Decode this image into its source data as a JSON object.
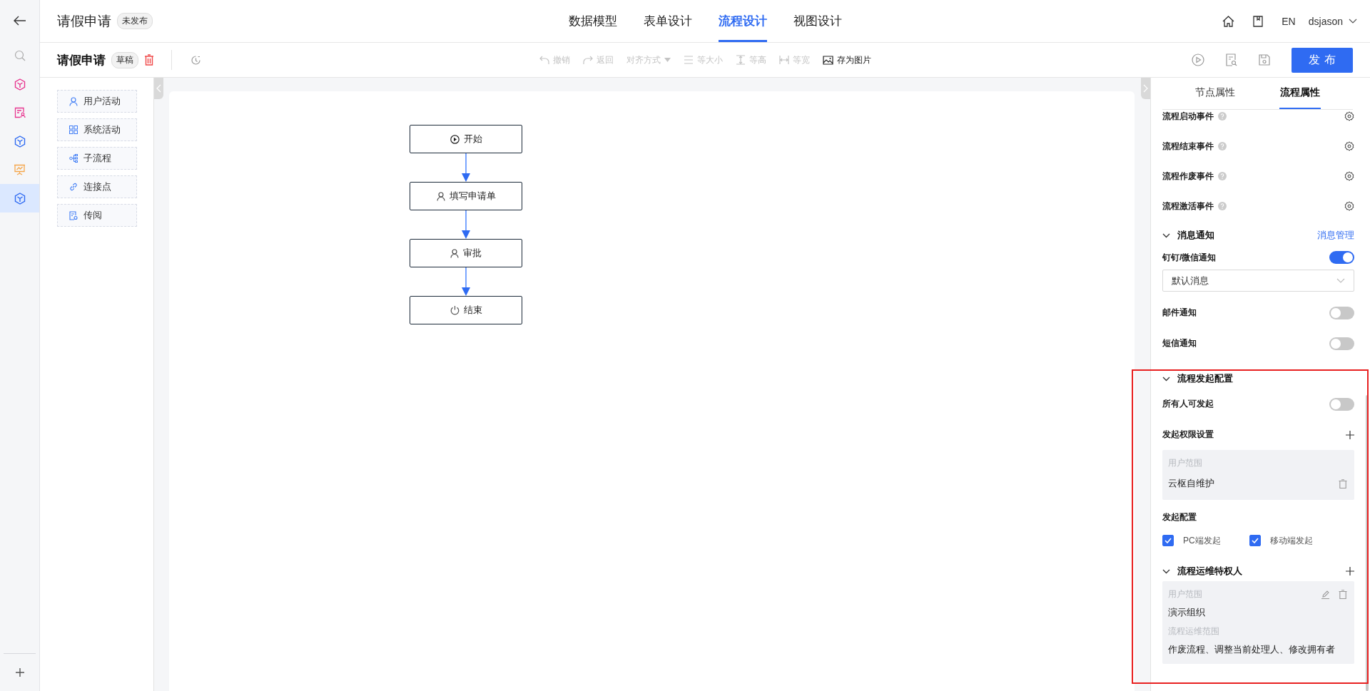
{
  "rail": {
    "items": [
      {
        "kind": "search",
        "selected": false
      },
      {
        "kind": "cube",
        "color": "#e8368f",
        "selected": false
      },
      {
        "kind": "form",
        "color": "#e8368f",
        "selected": false
      },
      {
        "kind": "cube",
        "color": "#2f6bf2",
        "selected": false
      },
      {
        "kind": "board",
        "color": "#f5a74c",
        "selected": false
      },
      {
        "kind": "cube",
        "color": "#2f6bf2",
        "selected": true
      }
    ]
  },
  "header": {
    "title": "请假申请",
    "status": "未发布",
    "tabs": [
      {
        "label": "数据模型",
        "selected": false
      },
      {
        "label": "表单设计",
        "selected": false
      },
      {
        "label": "流程设计",
        "selected": true
      },
      {
        "label": "视图设计",
        "selected": false
      }
    ],
    "language": "EN",
    "user": "dsjason"
  },
  "toolbar": {
    "title": "请假申请",
    "status": "草稿",
    "actions": [
      {
        "kind": "undo",
        "label": "撤销",
        "disabled": true
      },
      {
        "kind": "redo",
        "label": "返回",
        "disabled": true
      },
      {
        "kind": "align",
        "label": "对齐方式",
        "disabled": true
      },
      {
        "kind": "same-size",
        "label": "等大小",
        "disabled": true
      },
      {
        "kind": "same-height",
        "label": "等高",
        "disabled": true
      },
      {
        "kind": "same-width",
        "label": "等宽",
        "disabled": true
      },
      {
        "kind": "image",
        "label": "存为图片",
        "disabled": false
      }
    ],
    "publish": "发布"
  },
  "palette": [
    {
      "kind": "user",
      "label": "用户活动"
    },
    {
      "kind": "grid",
      "label": "系统活动"
    },
    {
      "kind": "subflow",
      "label": "子流程"
    },
    {
      "kind": "link",
      "label": "连接点"
    },
    {
      "kind": "doc",
      "label": "传阅"
    }
  ],
  "flow": {
    "nodes": [
      {
        "kind": "start",
        "label": "开始"
      },
      {
        "kind": "user",
        "label": "填写申请单"
      },
      {
        "kind": "user",
        "label": "审批"
      },
      {
        "kind": "end",
        "label": "结束"
      }
    ]
  },
  "panel": {
    "tabs": [
      {
        "label": "节点属性",
        "selected": false
      },
      {
        "label": "流程属性",
        "selected": true
      }
    ],
    "events": [
      "流程启动事件",
      "流程结束事件",
      "流程作废事件",
      "流程激活事件"
    ],
    "notify": {
      "title": "消息通知",
      "expanded": true,
      "link": "消息管理",
      "channels": [
        {
          "label": "钉钉/微信通知",
          "on": true,
          "template": "默认消息"
        },
        {
          "label": "邮件通知",
          "on": false
        },
        {
          "label": "短信通知",
          "on": false
        }
      ]
    },
    "launch": {
      "title": "流程发起配置",
      "expanded": true,
      "everyone": {
        "label": "所有人可发起",
        "on": false
      },
      "permission_title": "发起权限设置",
      "scope_label": "用户范围",
      "scope": "云枢自维护",
      "config_title": "发起配置",
      "options": [
        {
          "label": "PC端发起",
          "checked": true
        },
        {
          "label": "移动端发起",
          "checked": true
        }
      ]
    },
    "admins": {
      "title": "流程运维特权人",
      "expanded": true,
      "scope_label": "用户范围",
      "scope": "演示组织",
      "range_label": "流程运维范围",
      "range": "作废流程、调整当前处理人、修改拥有者"
    }
  }
}
